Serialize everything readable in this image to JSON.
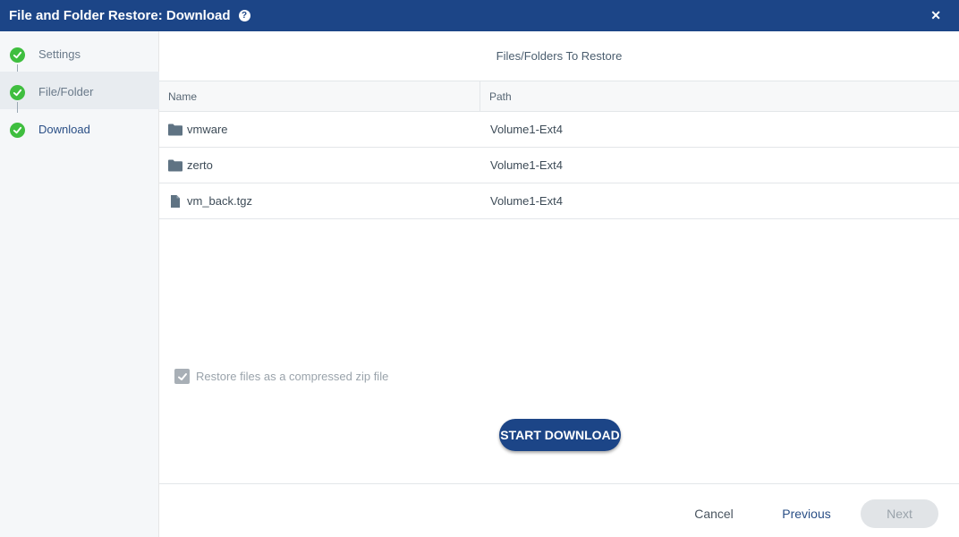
{
  "window": {
    "title": "File and Folder Restore: Download"
  },
  "steps": [
    {
      "label": "Settings"
    },
    {
      "label": "File/Folder"
    },
    {
      "label": "Download"
    }
  ],
  "main": {
    "section_title": "Files/Folders To Restore",
    "columns": {
      "name": "Name",
      "path": "Path"
    },
    "rows": [
      {
        "name": "vmware",
        "path": "Volume1-Ext4",
        "type": "folder-icon"
      },
      {
        "name": "zerto",
        "path": "Volume1-Ext4",
        "type": "folder-icon"
      },
      {
        "name": "vm_back.tgz",
        "path": "Volume1-Ext4",
        "type": "file-icon"
      }
    ],
    "zip_option": {
      "label": "Restore files as a compressed zip file",
      "checked": true
    },
    "start_button": "START DOWNLOAD"
  },
  "footer": {
    "cancel": "Cancel",
    "previous": "Previous",
    "next": "Next"
  },
  "colors": {
    "header": "#1c4587",
    "check": "#3fbe3f",
    "accent": "#2a4f86"
  }
}
